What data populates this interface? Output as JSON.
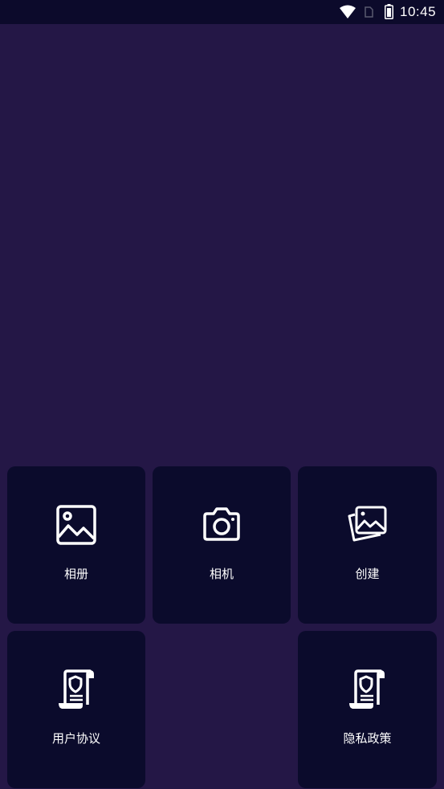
{
  "status_bar": {
    "time": "10:45",
    "icons": [
      "wifi-icon",
      "sim-card-icon",
      "battery-icon"
    ]
  },
  "menu": {
    "album_label": "相册",
    "camera_label": "相机",
    "create_label": "创建",
    "agreement_label": "用户协议",
    "privacy_label": "隐私政策"
  },
  "colors": {
    "background": "#241746",
    "card": "#0b0b2c",
    "status_bar": "#0c0a2b",
    "text": "#ffffff"
  }
}
